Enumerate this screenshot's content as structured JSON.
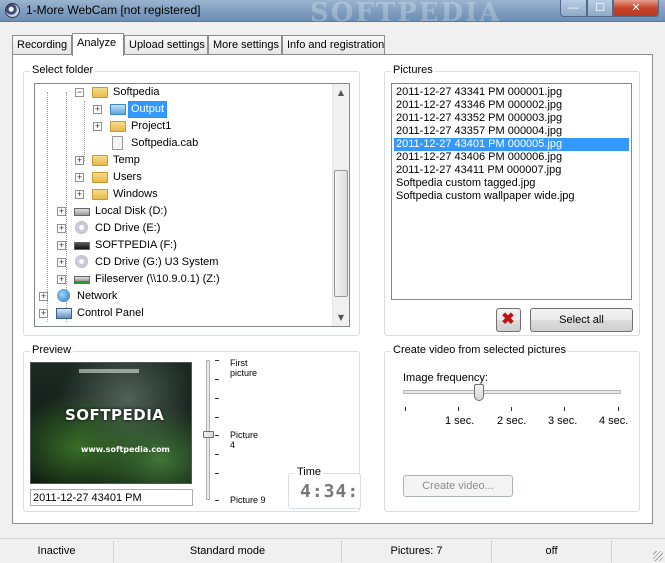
{
  "window": {
    "title": "1-More WebCam [not registered]",
    "watermark": "SOFTPEDIA",
    "minimize": "—",
    "maximize": "☐",
    "close": "✕"
  },
  "tabs": [
    {
      "label": "Recording"
    },
    {
      "label": "Analyze"
    },
    {
      "label": "Upload settings"
    },
    {
      "label": "More settings"
    },
    {
      "label": "Info and registration"
    }
  ],
  "folder_panel": {
    "label": "Select folder",
    "tree": [
      {
        "label": "Softpedia",
        "icon": "folder-icon"
      },
      {
        "label": "Output",
        "icon": "folder-icon",
        "selected": true
      },
      {
        "label": "Project1",
        "icon": "folder-icon"
      },
      {
        "label": "Softpedia.cab",
        "icon": "file-icon"
      },
      {
        "label": "Temp",
        "icon": "folder-icon"
      },
      {
        "label": "Users",
        "icon": "folder-icon"
      },
      {
        "label": "Windows",
        "icon": "folder-icon"
      },
      {
        "label": "Local Disk (D:)",
        "icon": "hard-drive-icon"
      },
      {
        "label": "CD Drive (E:)",
        "icon": "cd-drive-icon"
      },
      {
        "label": "SOFTPEDIA (F:)",
        "icon": "removable-drive-icon"
      },
      {
        "label": "CD Drive (G:) U3 System",
        "icon": "cd-drive-icon"
      },
      {
        "label": "Fileserver (\\\\10.9.0.1) (Z:)",
        "icon": "network-drive-icon"
      },
      {
        "label": "Network",
        "icon": "network-icon"
      },
      {
        "label": "Control Panel",
        "icon": "control-panel-icon"
      }
    ]
  },
  "pictures_panel": {
    "label": "Pictures",
    "items": [
      "2011-12-27 43341 PM 000001.jpg",
      "2011-12-27 43346 PM 000002.jpg",
      "2011-12-27 43352 PM 000003.jpg",
      "2011-12-27 43357 PM 000004.jpg",
      "2011-12-27 43401 PM 000005.jpg",
      "2011-12-27 43406 PM 000006.jpg",
      "2011-12-27 43411 PM 000007.jpg",
      "Softpedia custom tagged.jpg",
      "Softpedia custom wallpaper wide.jpg"
    ],
    "selected_index": 4,
    "delete_icon": "✖",
    "select_all_label": "Select all"
  },
  "preview_panel": {
    "label": "Preview",
    "image_logo": "SOFTPEDIA",
    "image_url": "www.softpedia.com",
    "filename": "2011-12-27 43401 PM",
    "slider": {
      "first_label_line1": "First",
      "first_label_line2": "picture",
      "mid_label_line1": "Picture",
      "mid_label_line2": "4",
      "last_label": "Picture 9"
    },
    "time_label": "Time",
    "time_value": "4:34:"
  },
  "video_panel": {
    "label": "Create video from selected pictures",
    "frequency_label": "Image frequency:",
    "frequency_level": 0.35,
    "ticks": [
      "1 sec.",
      "2 sec.",
      "3 sec.",
      "4 sec."
    ],
    "create_label": "Create video..."
  },
  "statusbar": {
    "state": "Inactive",
    "mode": "Standard mode",
    "pictures": "Pictures: 7",
    "flag": "off"
  }
}
